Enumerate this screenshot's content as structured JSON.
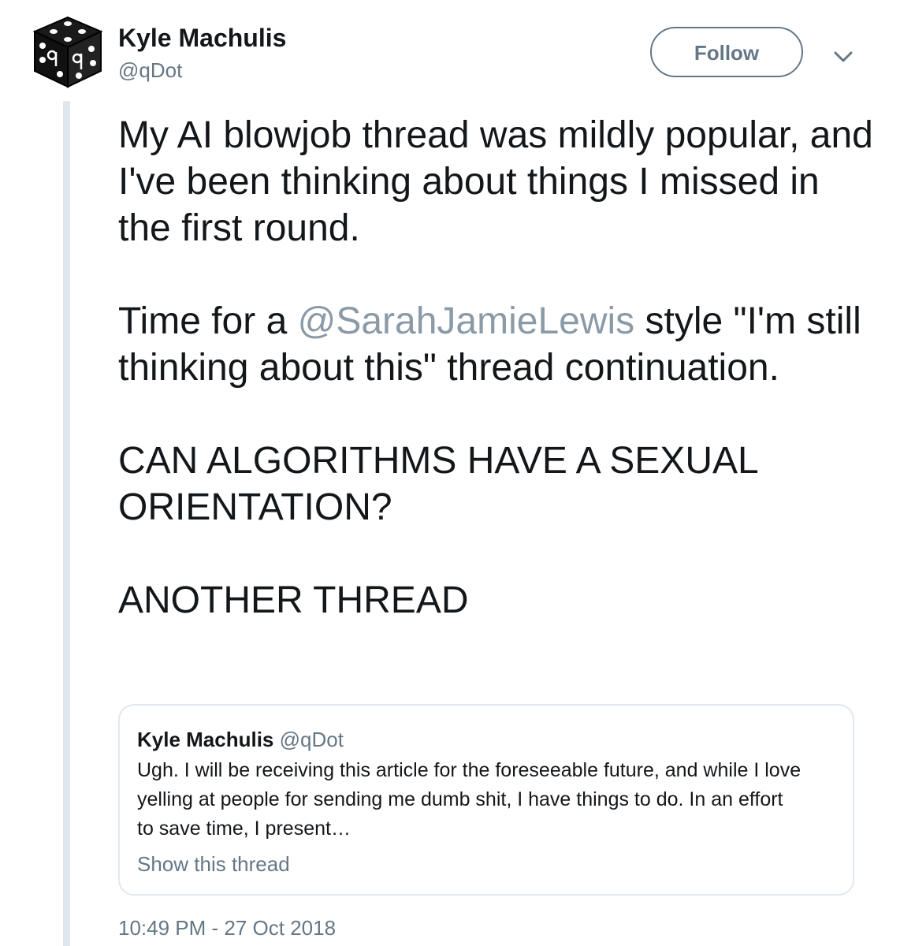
{
  "author": {
    "name": "Kyle Machulis",
    "handle": "@qDot"
  },
  "follow_button": {
    "label": "Follow"
  },
  "tweet": {
    "paragraph1": "My AI blowjob thread was mildly popular, and I've been thinking about things I missed in the first round.",
    "paragraph2_before": "Time for a ",
    "paragraph2_mention": "@SarahJamieLewis",
    "paragraph2_after": " style \"I'm still thinking about this\" thread continuation.",
    "paragraph3": "CAN ALGORITHMS HAVE A SEXUAL ORIENTATION?",
    "paragraph4": "ANOTHER THREAD"
  },
  "quoted_tweet": {
    "name": "Kyle Machulis",
    "handle": "@qDot",
    "lines": [
      "Ugh. I will be receiving this article for the foreseeable future, and while I love",
      "yelling at people for sending me dumb shit, I have things to do. In an effort",
      "to save time, I present…"
    ],
    "show_thread_label": "Show this thread"
  },
  "timestamp": "10:49 PM - 27 Oct 2018",
  "colors": {
    "text": "#14171a",
    "secondary": "#657786",
    "mention": "#8a9aa6",
    "border": "#e1e8ed"
  },
  "icons": {
    "avatar": "dice-cube-avatar",
    "caret": "chevron-down-icon"
  }
}
